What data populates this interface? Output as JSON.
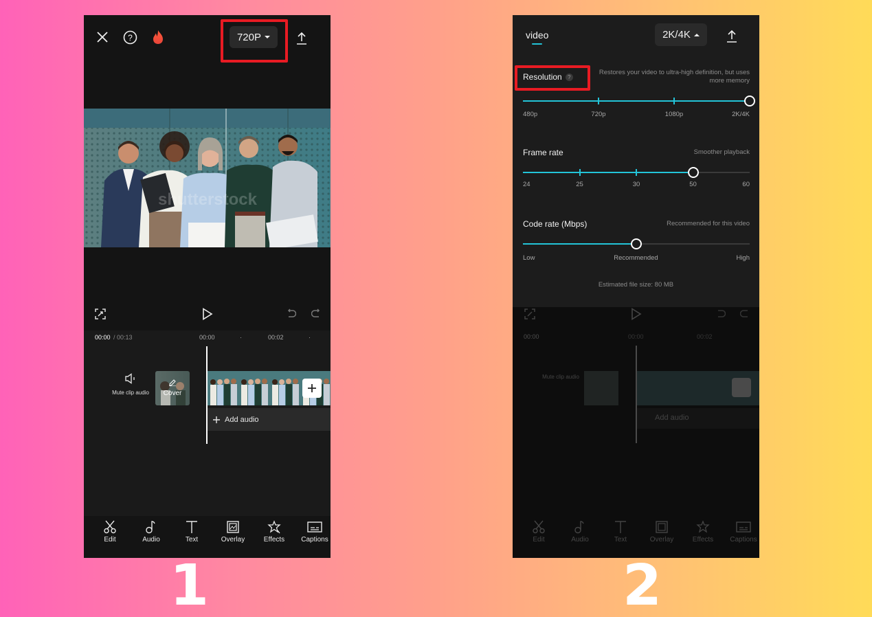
{
  "screen1": {
    "resolution_label": "720P",
    "icons": {
      "close": "close-icon",
      "help": "help-icon",
      "pro": "flame-icon",
      "export": "export-icon"
    },
    "preview_watermark": "shutterstock",
    "time_current": "00:00",
    "time_total": "/ 00:13",
    "ruler": [
      "00:00",
      "00:02"
    ],
    "mute_label": "Mute clip audio",
    "cover_label": "Cover",
    "add_audio_label": "Add audio",
    "toolbar": [
      {
        "label": "Edit",
        "icon": "scissors-icon"
      },
      {
        "label": "Audio",
        "icon": "music-note-icon"
      },
      {
        "label": "Text",
        "icon": "text-icon"
      },
      {
        "label": "Overlay",
        "icon": "overlay-icon"
      },
      {
        "label": "Effects",
        "icon": "effects-star-icon"
      },
      {
        "label": "Captions",
        "icon": "captions-icon"
      }
    ]
  },
  "screen2": {
    "tab_label": "video",
    "resolution_label": "2K/4K",
    "resolution": {
      "title": "Resolution",
      "hint": "Restores your video to ultra-high definition, but uses more memory",
      "options": [
        "480p",
        "720p",
        "1080p",
        "2K/4K"
      ],
      "selected": "2K/4K"
    },
    "frame_rate": {
      "title": "Frame rate",
      "hint": "Smoother playback",
      "options": [
        "24",
        "25",
        "30",
        "50",
        "60"
      ],
      "selected": "50"
    },
    "code_rate": {
      "title": "Code rate (Mbps)",
      "hint": "Recommended for this video",
      "labels": [
        "Low",
        "Recommended",
        "High"
      ],
      "selected": "Recommended",
      "fraction": 0.5
    },
    "file_size": "Estimated file size: 80 MB"
  },
  "steps": [
    "1",
    "2"
  ],
  "colors": {
    "accent": "#23c4d8",
    "highlight": "#e81b23",
    "panel": "#1c1c1c"
  }
}
